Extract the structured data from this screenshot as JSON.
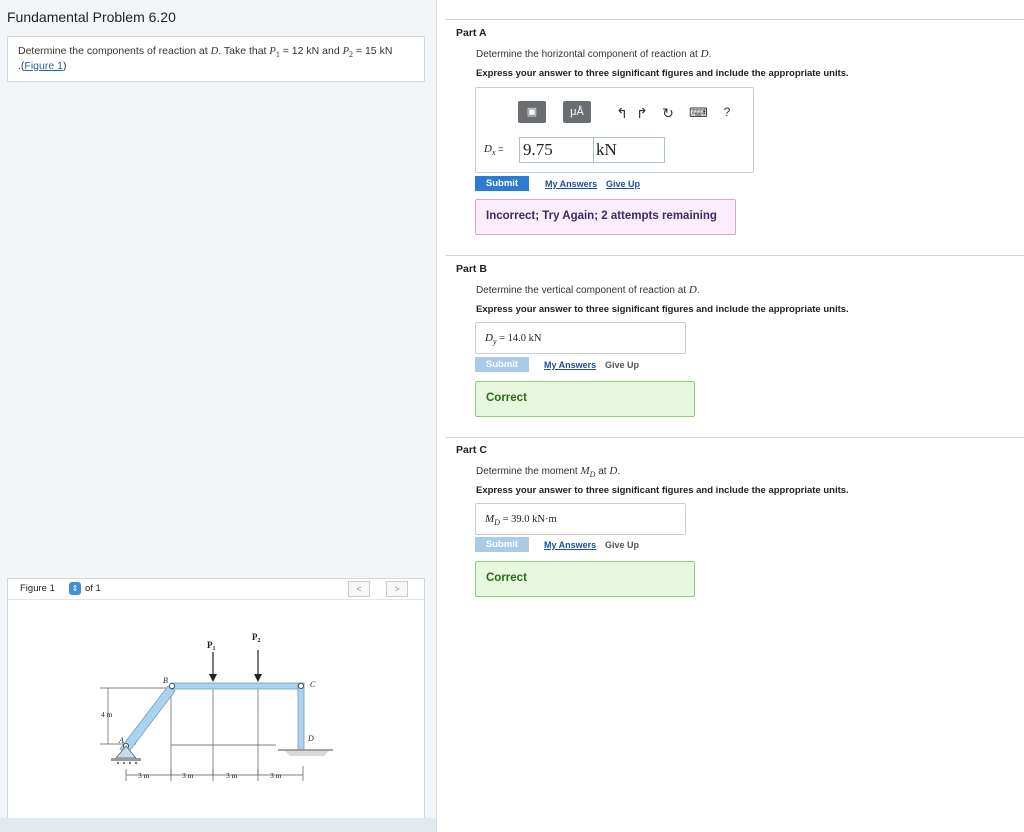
{
  "problem": {
    "title": "Fundamental Problem 6.20",
    "text_pre": "Determine the components of reaction at ",
    "var_D": "D",
    "text_mid": ". Take that ",
    "p1_var": "P",
    "p1_sub": "1",
    "p1_value": " = 12 kN",
    "and": " and ",
    "p2_var": "P",
    "p2_sub": "2",
    "p2_value": " = 15 kN",
    "figure_prefix": ".(",
    "figure_link": "Figure 1",
    "figure_suffix": ")"
  },
  "figure": {
    "label": "Figure 1",
    "of": "of 1",
    "prev": "<",
    "next": ">",
    "labels": {
      "P1": "P",
      "P1sub": "1",
      "P2": "P",
      "P2sub": "2",
      "B": "B",
      "C": "C",
      "A": "A",
      "D": "D",
      "height": "4 m",
      "d1": "3 m",
      "d2": "3 m",
      "d3": "3 m",
      "d4": "3 m"
    }
  },
  "partA": {
    "title": "Part A",
    "question_pre": "Determine the horizontal component of reaction at ",
    "question_var": "D",
    "question_post": ".",
    "instruction": "Express your answer to three significant figures and include the appropriate units.",
    "toolbar": {
      "template": "▣",
      "units": "μÅ",
      "undo": "↰",
      "redo": "↱",
      "reset": "↻",
      "keyboard": "⌨",
      "help": "?"
    },
    "var_label": "D",
    "var_sub": "x",
    "equals": " =",
    "value": "9.75",
    "unit": "kN",
    "submit": "Submit",
    "my_answers": "My Answers",
    "give_up": "Give Up",
    "feedback": "Incorrect; Try Again; 2 attempts remaining"
  },
  "partB": {
    "title": "Part B",
    "question_pre": "Determine the vertical component of reaction at ",
    "question_var": "D",
    "question_post": ".",
    "instruction": "Express your answer to three significant figures and include the appropriate units.",
    "var_label": "D",
    "var_sub": "y",
    "answer": " =  14.0 kN",
    "submit": "Submit",
    "my_answers": "My Answers",
    "give_up": "Give Up",
    "feedback": "Correct"
  },
  "partC": {
    "title": "Part C",
    "question_pre": "Determine the moment ",
    "question_var": "M",
    "question_sub": "D",
    "question_mid": " at ",
    "question_var2": "D",
    "question_post": ".",
    "instruction": "Express your answer to three significant figures and include the appropriate units.",
    "var_label": "M",
    "var_sub": "D",
    "answer": " =  39.0 kN·m",
    "submit": "Submit",
    "my_answers": "My Answers",
    "give_up": "Give Up",
    "feedback": "Correct"
  },
  "colors": {
    "submit_active": "#2d7bd3",
    "submit_disabled": "#a9cbe8",
    "link": "#1d4e9a",
    "incorrect_bg": "#fbeefa",
    "correct_bg": "#e7f8df",
    "correct_text": "#2b6b12",
    "incorrect_text": "#3a2a6b",
    "frame_member": "#a9d3ee"
  }
}
